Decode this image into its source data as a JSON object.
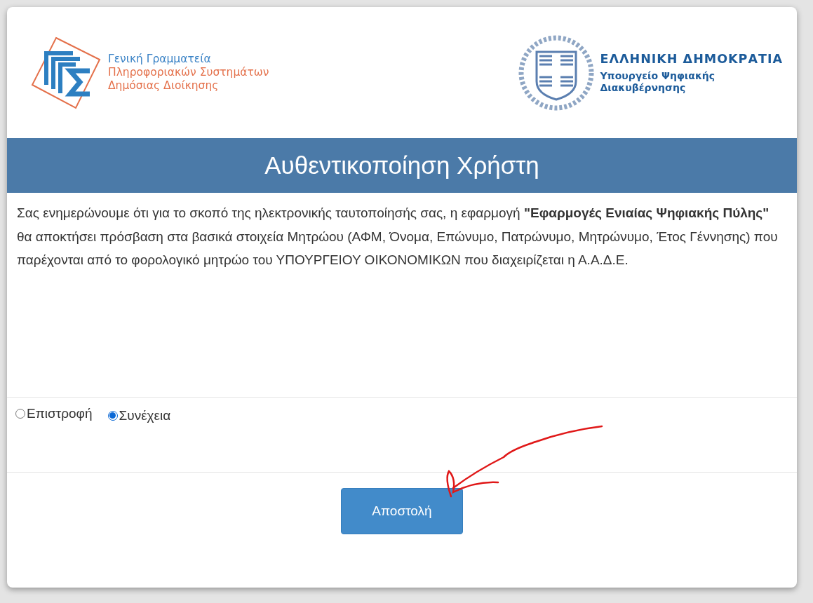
{
  "header": {
    "left_logo": {
      "lines": [
        "Γενική Γραμματεία",
        "Πληροφοριακών Συστημάτων",
        "Δημόσιας Διοίκησης"
      ]
    },
    "right_logo": {
      "title": "ΕΛΛΗΝΙΚΗ ΔΗΜΟΚΡΑΤΙΑ",
      "lines": [
        "Υπουργείο Ψηφιακής",
        "Διακυβέρνησης"
      ]
    }
  },
  "title": "Αυθεντικοποίηση Χρήστη",
  "message": "Σας ενημερώνουμε ότι για το σκοπό της ηλεκτρονικής ταυτοποίησής σας, η εφαρμογή **\"Εφαρμογές Ενιαίας Ψηφιακής Πύλης\"** θα αποκτήσει πρόσβαση στα βασικά στοιχεία Μητρώου (ΑΦΜ, Όνομα, Επώνυμο, Πατρώνυμο, Μητρώνυμο, Έτος Γέννησης) που παρέχονται από το φορολογικό μητρώο του ΥΠΟΥΡΓΕΙΟΥ ΟΙΚΟΝΟΜΙΚΩΝ που διαχειρίζεται η Α.Α.Δ.Ε.",
  "options": [
    {
      "label": "Επιστροφή",
      "selected": false
    },
    {
      "label": "Συνέχεια",
      "selected": true
    }
  ],
  "submit": "Αποστολή"
}
